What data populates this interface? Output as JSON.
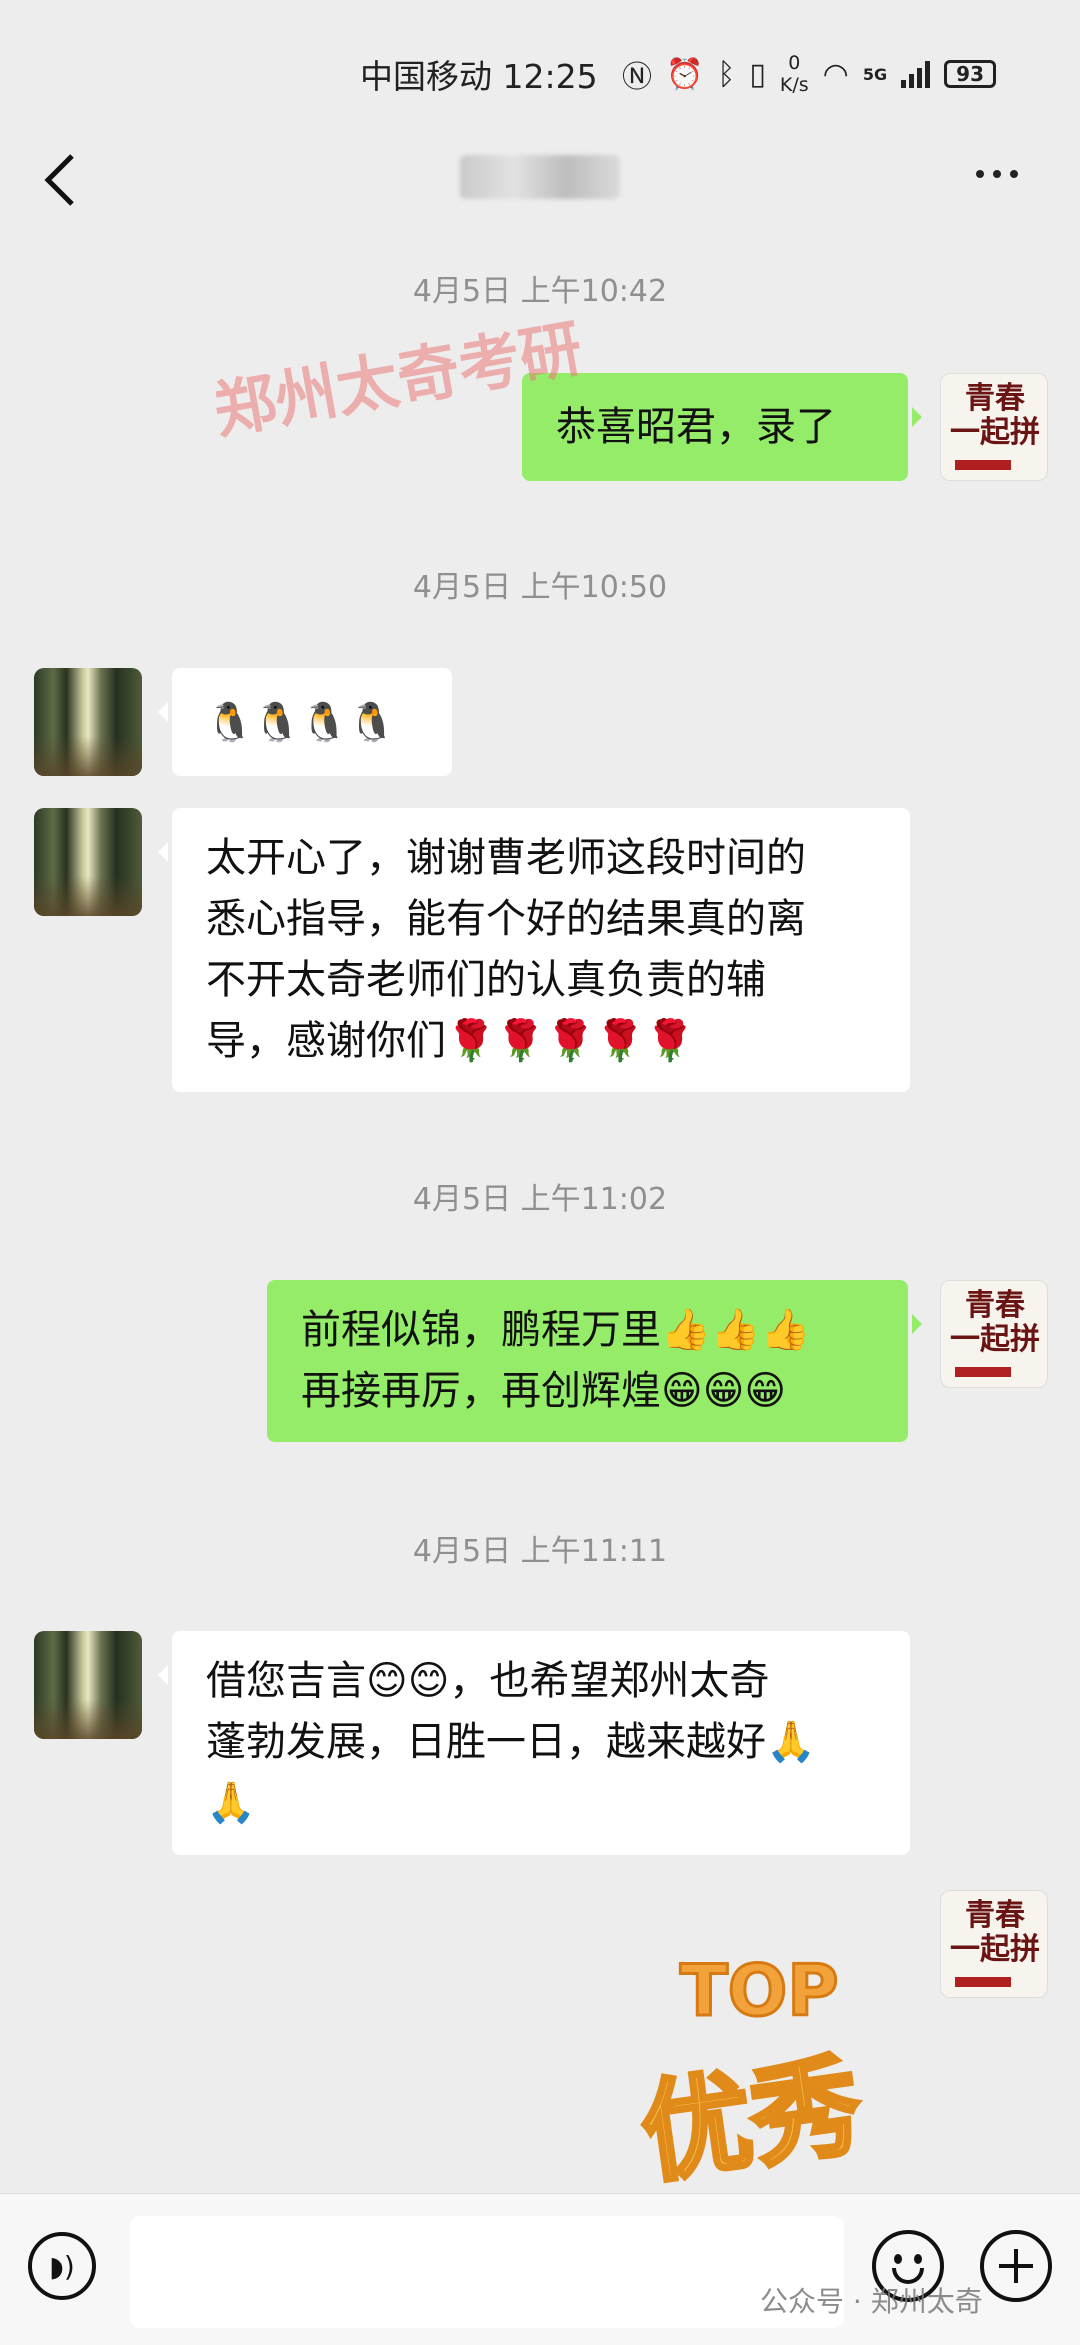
{
  "status_bar": {
    "carrier_time": "中国移动 12:25",
    "speed_value": "0",
    "speed_unit": "K/s",
    "network": "5G",
    "battery": "93"
  },
  "header": {
    "contact_name": "卜研",
    "more_icon": "more-icon",
    "back_icon": "back-arrow-icon"
  },
  "watermark": "郑州太奇考研",
  "messages": [
    {
      "type": "time",
      "text": "4月5日 上午10:42"
    },
    {
      "type": "out",
      "text": "恭喜昭君，录了"
    },
    {
      "type": "time",
      "text": "4月5日 上午10:50"
    },
    {
      "type": "in",
      "text": "🐧🐧🐧🐧"
    },
    {
      "type": "in",
      "text": "太开心了，谢谢曹老师这段时间的\n悉心指导，能有个好的结果真的离\n不开太奇老师们的认真负责的辅\n导，感谢你们🌹🌹🌹🌹🌹"
    },
    {
      "type": "time",
      "text": "4月5日 上午11:02"
    },
    {
      "type": "out",
      "text": "前程似锦，鹏程万里👍👍👍\n再接再厉，再创辉煌😁😁😁"
    },
    {
      "type": "time",
      "text": "4月5日 上午11:11"
    },
    {
      "type": "in",
      "text": "借您吉言😊😊，也希望郑州太奇\n蓬勃发展，日胜一日，越来越好🙏\n🙏"
    },
    {
      "type": "sticker",
      "top": "TOP",
      "main": "优秀"
    }
  ],
  "avatar_brand_text": "青春\n一起拼",
  "input_bar": {
    "placeholder": "",
    "voice_icon": "voice-icon",
    "emoji_icon": "emoji-icon",
    "plus_icon": "plus-icon"
  },
  "footer_watermark": "公众号 · 郑州太奇"
}
